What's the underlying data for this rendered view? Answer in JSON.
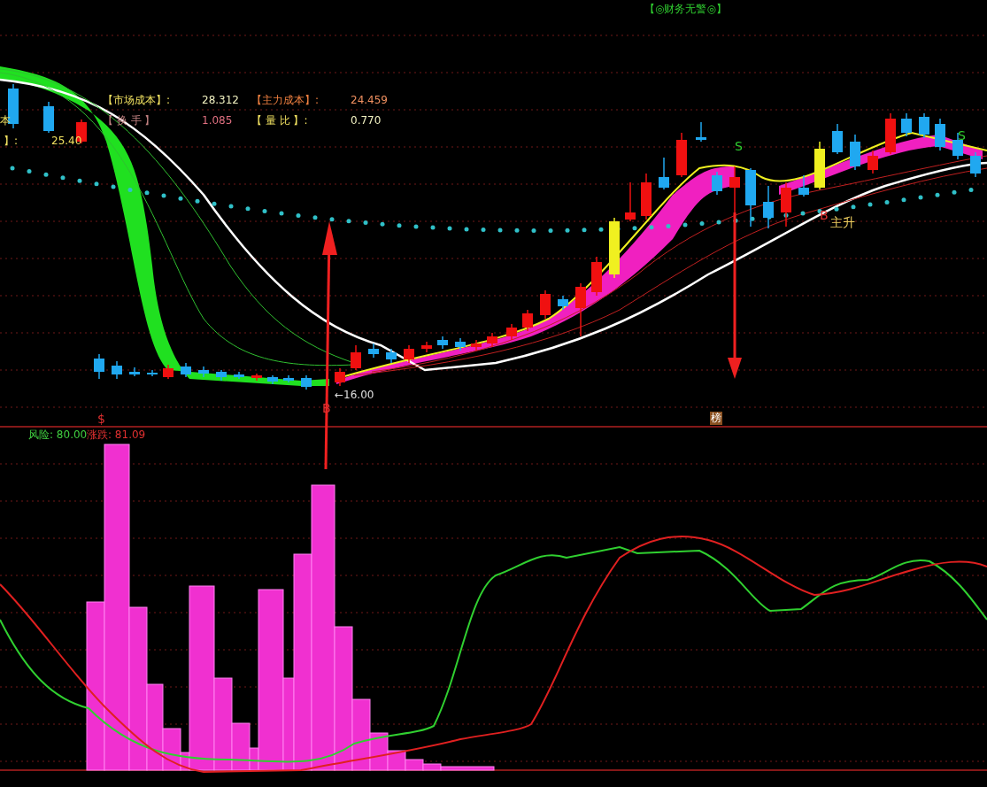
{
  "header": {
    "title": "【◎财务无警◎】"
  },
  "info": [
    {
      "label": "【市场成本】:",
      "value": "28.312"
    },
    {
      "label": "【主力成本】:",
      "value": "24.459"
    },
    {
      "label": "【 换 手 】",
      "value": "1.085"
    },
    {
      "label": "【 量 比 】:",
      "value": "0.770"
    }
  ],
  "left_fragments": [
    {
      "text": "本"
    },
    {
      "text": "】:"
    },
    {
      "text": "25.40"
    }
  ],
  "signals": [
    {
      "text": "S",
      "kind": "sell"
    },
    {
      "text": "S",
      "kind": "sell"
    },
    {
      "text": "B",
      "kind": "buy"
    },
    {
      "text": "B",
      "kind": "buy"
    },
    {
      "text": "主升",
      "kind": "note"
    },
    {
      "text": "$",
      "kind": "buy"
    }
  ],
  "low_price": "←16.00",
  "badge": "榜",
  "indicator": {
    "items": [
      {
        "label": "风险:",
        "value": "80.00",
        "color": "#40d040"
      },
      {
        "label": "涨跌:",
        "value": "81.09",
        "color": "#e03030"
      }
    ]
  }
}
